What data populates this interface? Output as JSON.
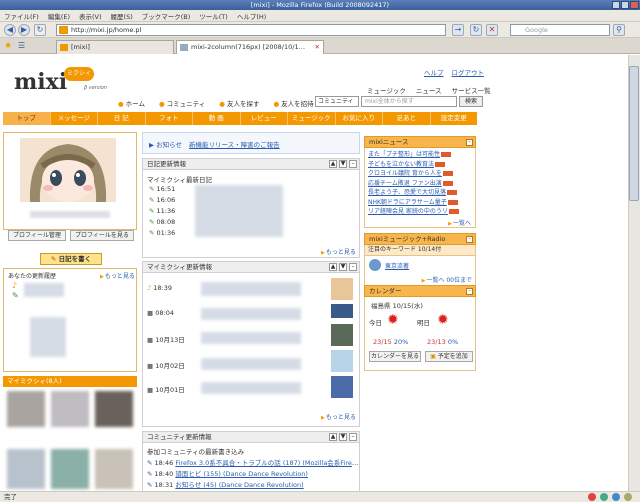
{
  "window": {
    "title": "[mixi] - Mozilla Firefox (Build 2008092417)"
  },
  "menu": [
    "ファイル(F)",
    "編集(E)",
    "表示(V)",
    "履歴(S)",
    "ブックマーク(B)",
    "ツール(T)",
    "ヘルプ(H)"
  ],
  "nav": {
    "url": "http://mixi.jp/home.pl",
    "search_placeholder": "Google"
  },
  "tabs": [
    {
      "label": "[mixi]"
    },
    {
      "label": "mixi-2column(716px) [2008/10/13] | us..."
    }
  ],
  "status": "完了",
  "logo": {
    "text": "mixi",
    "badge": "ミクシィ",
    "sub": "β version"
  },
  "header": {
    "help": "ヘルプ",
    "logout": "ログアウト",
    "services": [
      "ミュージック",
      "ニュース",
      "サービス一覧"
    ],
    "sub": [
      "ホーム",
      "コミュニティ",
      "友人を探す",
      "友人を招待"
    ],
    "search_select": "コミュニティ",
    "search_placeholder": "mixi全体から探す",
    "search_button": "検索"
  },
  "globalnav": [
    "トップ",
    "メッセージ",
    "日 記",
    "フォト",
    "動 画",
    "レビュー",
    "ミュージック",
    "お気に入り",
    "足あと",
    "設定変更"
  ],
  "left": {
    "profile_manage": "プロフィール管理",
    "profile_view": "プロフィールを見る",
    "write_diary": "日記を書く",
    "updates_title": "あなたの更新履歴",
    "updates_more": "もっと見る",
    "mymixi_title": "マイミクシィ(8人)"
  },
  "notice": {
    "label": "お知らせ",
    "link": "新機能リリース・障害のご報告"
  },
  "diary": {
    "title": "日記更新情報",
    "subtitle": "マイミクシィ最新日記",
    "times": [
      "16:51",
      "16:06",
      "11:36",
      "08:08",
      "01:36"
    ],
    "more": "もっと見る"
  },
  "mymixi_updates": {
    "title": "マイミクシィ更新情報",
    "times": [
      "18:39",
      "08:04",
      "10月13日",
      "10月02日",
      "10月01日"
    ],
    "more": "もっと見る"
  },
  "community": {
    "title": "コミュニティ更新情報",
    "subtitle": "参加コミュニティの最新書き込み",
    "items": [
      {
        "time": "18:46",
        "text": "Firefox 3.0系不具合・トラブルの話 (187) (Mozilla会系Firefox組)"
      },
      {
        "time": "18:40",
        "text": "譜面ヒビ (155) (Dance Dance Revolution)"
      },
      {
        "time": "18:31",
        "text": "お知らせ (45) (Dance Dance Revolution)"
      }
    ]
  },
  "news": {
    "title": "mixiニュース",
    "items": [
      "また「プチ整形」は可能性",
      "子どもを泣かない教育法",
      "クロヨイル議院 育から人を",
      "応援チーム敗退 ファン出演",
      "長老よう子、恐愛で大切見落",
      "NHK朝ドラにアラサーム量子",
      "リア経陣会見 家続の中のうリ"
    ],
    "more": "一覧へ"
  },
  "radio": {
    "title": "mixiミュージック+Radio",
    "keyword_title": "注目のキーワード 10/14付",
    "keyword": "東京流著",
    "more": "一覧へ 00位まで"
  },
  "calendar": {
    "title": "カレンダー",
    "date": "福島県 10/15(水)",
    "today_label": "今日",
    "tomorrow_label": "明日",
    "today_temp": "23/15",
    "today_rain": "20%",
    "tomorrow_temp": "23/13",
    "tomorrow_rain": "0%",
    "view_button": "カレンダーを見る",
    "add_button": "予定を追加"
  }
}
